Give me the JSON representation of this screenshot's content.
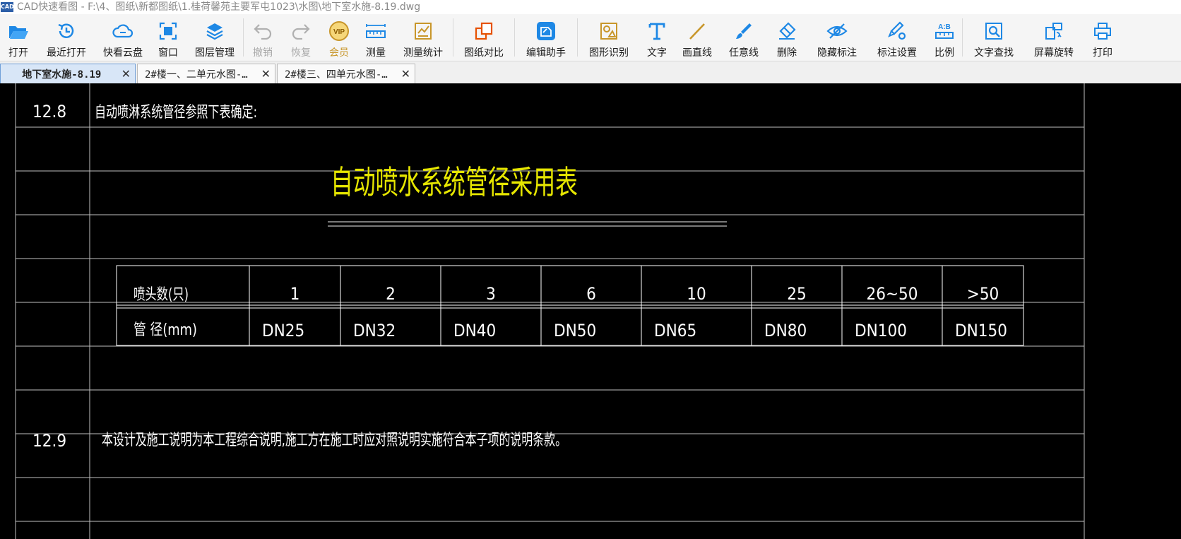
{
  "window": {
    "title": "CAD快速看图 - F:\\4、图纸\\新都图纸\\1.桂荷馨苑主要军屯1023\\水图\\地下室水施-8.19.dwg",
    "app_icon_text": "CAD"
  },
  "toolbar": {
    "open": "打开",
    "recent": "最近打开",
    "cloud": "快看云盘",
    "window": "窗口",
    "layers": "图层管理",
    "undo": "撤销",
    "redo": "恢复",
    "vip": "会员",
    "measure": "测量",
    "measure_stats": "测量统计",
    "compare": "图纸对比",
    "edit_assistant": "编辑助手",
    "shape_recognition": "图形识别",
    "text": "文字",
    "line": "画直线",
    "freehand": "任意线",
    "delete": "删除",
    "hide_marks": "隐藏标注",
    "mark_settings": "标注设置",
    "scale": "比例",
    "text_search": "文字查找",
    "rotate": "屏幕旋转",
    "print": "打印",
    "vip_badge": "VIP",
    "scale_badge": "A:B"
  },
  "tabs": [
    {
      "label": "地下室水施-8.19",
      "active": true
    },
    {
      "label": "2#楼一、二单元水图-…",
      "active": false
    },
    {
      "label": "2#楼三、四单元水图-…",
      "active": false
    }
  ],
  "tab_close_glyph": "✕",
  "drawing": {
    "row_12_8": {
      "number": "12.8",
      "text": "自动喷淋系统管径参照下表确定:"
    },
    "table_title": "自动喷水系统管径采用表",
    "table": {
      "header_label": "喷头数(只)",
      "counts": [
        "1",
        "2",
        "3",
        "6",
        "10",
        "25",
        "26~50",
        ">50"
      ],
      "diameter_label": "管 径(mm)",
      "diameters": [
        "DN25",
        "DN32",
        "DN40",
        "DN50",
        "DN65",
        "DN80",
        "DN100",
        "DN150"
      ]
    },
    "row_12_9": {
      "number": "12.9",
      "text": "本设计及施工说明为本工程综合说明,施工方在施工时应对照说明实施符合本子项的说明条款。"
    }
  },
  "colors": {
    "accent": "#1e88e5",
    "vip": "#c8962a",
    "cad_line": "#bfbfbf",
    "cad_text": "#ffffff",
    "cad_title": "#e6e600"
  }
}
